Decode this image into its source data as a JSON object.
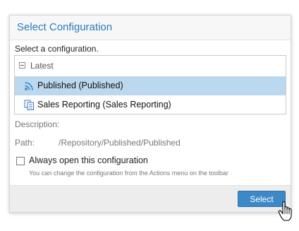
{
  "dialog": {
    "title": "Select Configuration",
    "prompt": "Select a configuration.",
    "tree": {
      "group_label": "Latest",
      "group_icon": "minus-icon",
      "items": [
        {
          "label": "Published (Published)",
          "icon": "rss-feed-icon",
          "selected": true
        },
        {
          "label": "Sales Reporting (Sales Reporting)",
          "icon": "copy-documents-icon",
          "selected": false
        }
      ]
    },
    "description_label": "Description:",
    "path_label": "Path:",
    "path_value": "/Repository/Published/Published",
    "checkbox": {
      "label": "Always open this configuration",
      "checked": false
    },
    "hint": "You can change the configuration from the Actions menu on the toolbar",
    "select_button": "Select"
  },
  "colors": {
    "title": "#2a7bbd",
    "selected_row": "#bcd8ef",
    "button": "#3d89c7",
    "rss_icon": "#4a8fd0"
  }
}
